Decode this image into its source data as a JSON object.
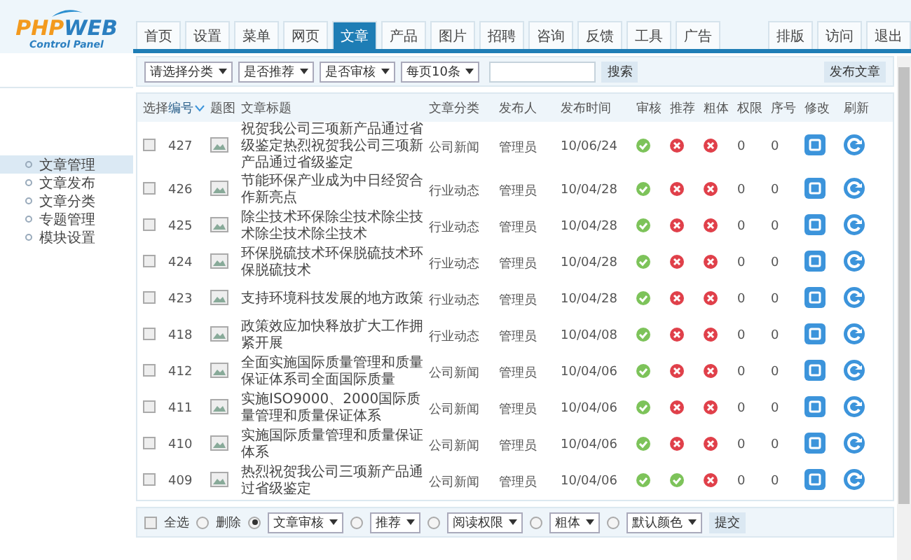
{
  "logo": {
    "prefix": "PHP",
    "suffix": "WEB",
    "subtitle": "Control Panel"
  },
  "tabs": [
    {
      "label": "首页",
      "selected": false
    },
    {
      "label": "设置",
      "selected": false
    },
    {
      "label": "菜单",
      "selected": false
    },
    {
      "label": "网页",
      "selected": false
    },
    {
      "label": "文章",
      "selected": true
    },
    {
      "label": "产品",
      "selected": false
    },
    {
      "label": "图片",
      "selected": false
    },
    {
      "label": "招聘",
      "selected": false
    },
    {
      "label": "咨询",
      "selected": false
    },
    {
      "label": "反馈",
      "selected": false
    },
    {
      "label": "工具",
      "selected": false
    },
    {
      "label": "广告",
      "selected": false
    }
  ],
  "right_tabs": [
    "排版",
    "访问",
    "退出"
  ],
  "sidebar": {
    "items": [
      {
        "label": "文章管理",
        "selected": true
      },
      {
        "label": "文章发布",
        "selected": false
      },
      {
        "label": "文章分类",
        "selected": false
      },
      {
        "label": "专题管理",
        "selected": false
      },
      {
        "label": "模块设置",
        "selected": false
      }
    ]
  },
  "filters": {
    "selects": [
      "请选择分类",
      "是否推荐",
      "是否审核",
      "每页10条"
    ],
    "search_button": "搜索",
    "publish_button": "发布文章"
  },
  "table": {
    "columns": [
      {
        "label": "选择",
        "sorted": false
      },
      {
        "label": "编号",
        "sorted": true
      },
      {
        "label": "题图",
        "sorted": false
      },
      {
        "label": "文章标题",
        "sorted": false
      },
      {
        "label": "文章分类",
        "sorted": false
      },
      {
        "label": "发布人",
        "sorted": false
      },
      {
        "label": "发布时间",
        "sorted": false
      },
      {
        "label": "审核",
        "sorted": false
      },
      {
        "label": "推荐",
        "sorted": false
      },
      {
        "label": "粗体",
        "sorted": false
      },
      {
        "label": "权限",
        "sorted": false
      },
      {
        "label": "序号",
        "sorted": false
      },
      {
        "label": "修改",
        "sorted": false
      },
      {
        "label": "刷新",
        "sorted": false
      }
    ],
    "rows": [
      {
        "checked": false,
        "id": "427",
        "title": "祝贺我公司三项新产品通过省级鉴定热烈祝贺我公司三项新产品通过省级鉴定",
        "category": "公司新闻",
        "author": "管理员",
        "date": "10/06/24",
        "audited": true,
        "recommended": false,
        "bold": false,
        "permission": "0",
        "order": "0"
      },
      {
        "checked": false,
        "id": "426",
        "title": "节能环保产业成为中日经贸合作新亮点",
        "category": "行业动态",
        "author": "管理员",
        "date": "10/04/28",
        "audited": true,
        "recommended": false,
        "bold": false,
        "permission": "0",
        "order": "0"
      },
      {
        "checked": false,
        "id": "425",
        "title": "除尘技术环保除尘技术除尘技术除尘技术除尘技术",
        "category": "行业动态",
        "author": "管理员",
        "date": "10/04/28",
        "audited": true,
        "recommended": false,
        "bold": false,
        "permission": "0",
        "order": "0"
      },
      {
        "checked": false,
        "id": "424",
        "title": "环保脱硫技术环保脱硫技术环保脱硫技术",
        "category": "行业动态",
        "author": "管理员",
        "date": "10/04/28",
        "audited": true,
        "recommended": false,
        "bold": false,
        "permission": "0",
        "order": "0"
      },
      {
        "checked": false,
        "id": "423",
        "title": "支持环境科技发展的地方政策",
        "category": "行业动态",
        "author": "管理员",
        "date": "10/04/28",
        "audited": true,
        "recommended": false,
        "bold": false,
        "permission": "0",
        "order": "0"
      },
      {
        "checked": false,
        "id": "418",
        "title": "政策效应加快释放扩大工作拥紧开展",
        "category": "行业动态",
        "author": "管理员",
        "date": "10/04/08",
        "audited": true,
        "recommended": false,
        "bold": false,
        "permission": "0",
        "order": "0"
      },
      {
        "checked": false,
        "id": "412",
        "title": "全面实施国际质量管理和质量保证体系司全面国际质量",
        "category": "公司新闻",
        "author": "管理员",
        "date": "10/04/06",
        "audited": true,
        "recommended": false,
        "bold": false,
        "permission": "0",
        "order": "0"
      },
      {
        "checked": false,
        "id": "411",
        "title": "实施ISO9000、2000国际质量管理和质量保证体系",
        "category": "公司新闻",
        "author": "管理员",
        "date": "10/04/06",
        "audited": true,
        "recommended": false,
        "bold": false,
        "permission": "0",
        "order": "0"
      },
      {
        "checked": false,
        "id": "410",
        "title": "实施国际质量管理和质量保证体系",
        "category": "公司新闻",
        "author": "管理员",
        "date": "10/04/06",
        "audited": true,
        "recommended": false,
        "bold": false,
        "permission": "0",
        "order": "0"
      },
      {
        "checked": false,
        "id": "409",
        "title": "热烈祝贺我公司三项新产品通过省级鉴定",
        "category": "公司新闻",
        "author": "管理员",
        "date": "10/04/06",
        "audited": true,
        "recommended": true,
        "bold": false,
        "permission": "0",
        "order": "0"
      }
    ]
  },
  "batch": {
    "select_all": {
      "label": "全选",
      "checked": false
    },
    "actions": [
      {
        "kind": "radio",
        "label": "删除",
        "selected": false
      },
      {
        "kind": "select",
        "value": "文章审核",
        "selected": true
      },
      {
        "kind": "select",
        "value": "推荐",
        "selected": false
      },
      {
        "kind": "select",
        "value": "阅读权限",
        "selected": false
      },
      {
        "kind": "select",
        "value": "粗体",
        "selected": false
      },
      {
        "kind": "select",
        "value": "默认颜色",
        "selected": false
      }
    ],
    "submit": "提交"
  }
}
